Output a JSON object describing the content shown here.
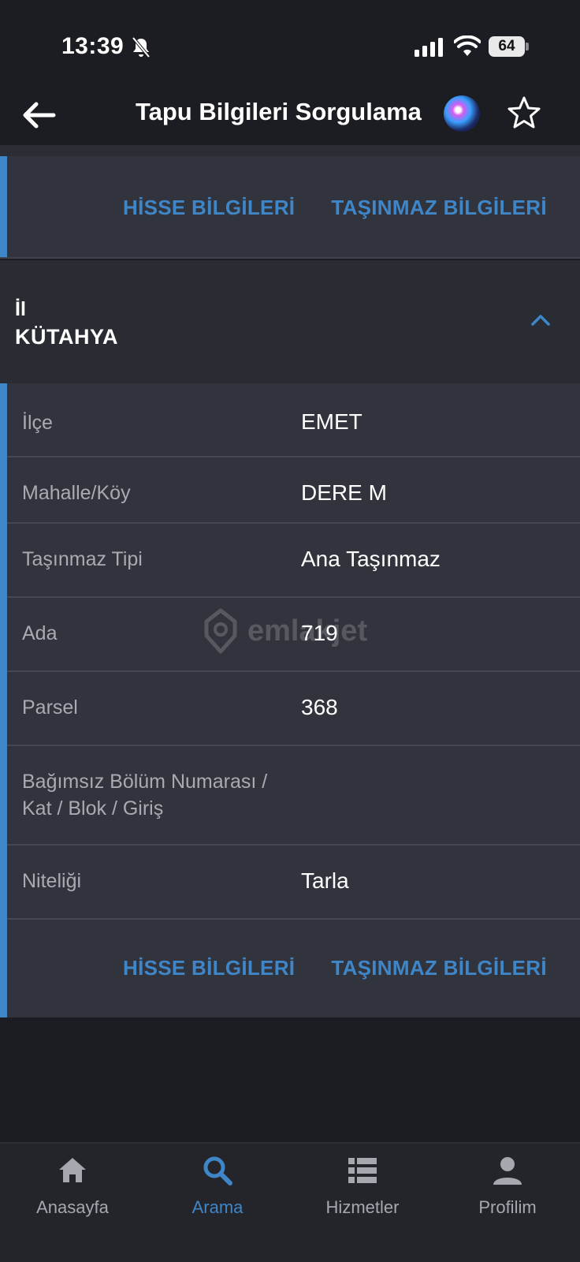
{
  "status_bar": {
    "time": "13:39",
    "battery": "64",
    "icons": [
      "bell-slash-icon",
      "signal-icon",
      "wifi-icon",
      "battery-icon"
    ]
  },
  "header": {
    "title": "Tapu Bilgileri Sorgulama",
    "icons": [
      "back-arrow-icon",
      "siri-icon",
      "star-icon"
    ]
  },
  "top_card": {
    "links": [
      "HİSSE BİLGİLERİ",
      "TAŞINMAZ BİLGİLERİ"
    ]
  },
  "section": {
    "label": "İl",
    "value": "KÜTAHYA"
  },
  "details": {
    "rows": [
      {
        "label": "İlçe",
        "value": "EMET"
      },
      {
        "label": "Mahalle/Köy",
        "value": "DERE M"
      },
      {
        "label": "Taşınmaz Tipi",
        "value": "Ana Taşınmaz"
      },
      {
        "label": "Ada",
        "value": "719"
      },
      {
        "label": "Parsel",
        "value": "368"
      },
      {
        "label": "Bağımsız Bölüm Numarası /",
        "label2": "Kat / Blok / Giriş",
        "value": ""
      },
      {
        "label": "Niteliği",
        "value": "Tarla"
      }
    ],
    "links": [
      "HİSSE BİLGİLERİ",
      "TAŞINMAZ BİLGİLERİ"
    ]
  },
  "watermark": "emlakjet",
  "bottom_nav": [
    {
      "label": "Anasayfa",
      "icon": "home-icon",
      "active": false
    },
    {
      "label": "Arama",
      "icon": "search-icon",
      "active": true
    },
    {
      "label": "Hizmetler",
      "icon": "list-icon",
      "active": false
    },
    {
      "label": "Profilim",
      "icon": "person-icon",
      "active": false
    }
  ],
  "colors": {
    "accent": "#3f86c9",
    "background": "#1c1d22",
    "card": "#32343d"
  }
}
